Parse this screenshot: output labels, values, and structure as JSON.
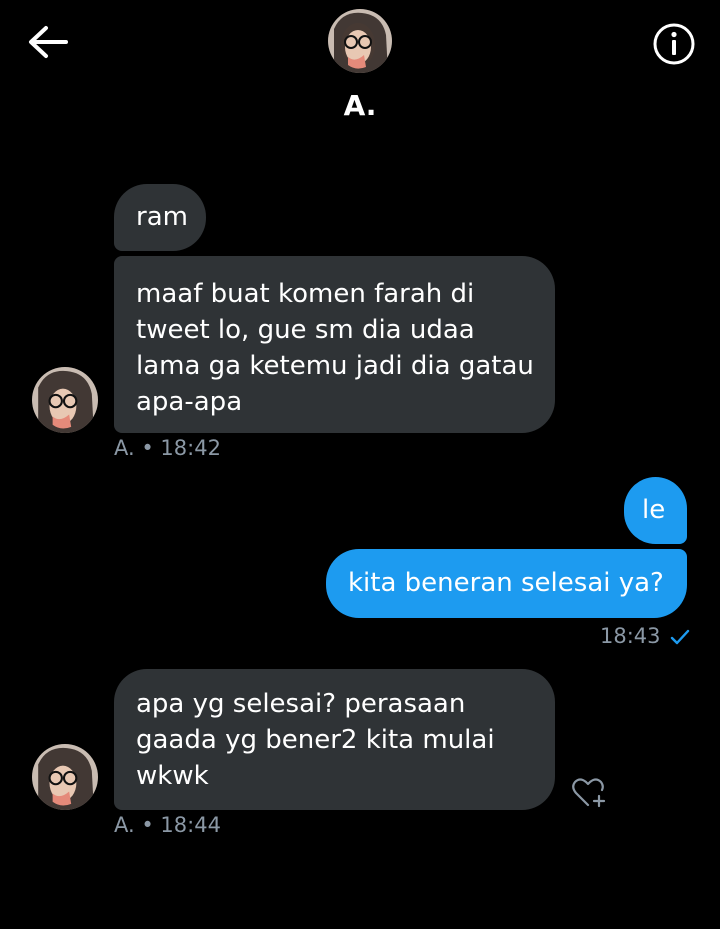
{
  "header": {
    "name": "A.",
    "back_icon": "arrow-left-icon",
    "info_icon": "info-icon"
  },
  "messages": [
    {
      "side": "in",
      "text": "ram"
    },
    {
      "side": "in",
      "lines": [
        "maaf buat komen farah di",
        "tweet lo, gue sm dia udaa",
        "lama ga ketemu jadi dia gatau",
        "apa-apa"
      ]
    },
    {
      "side": "out",
      "text": "le"
    },
    {
      "side": "out",
      "text": "kita beneran selesai ya?"
    },
    {
      "side": "in",
      "lines": [
        "apa yg selesai? perasaan",
        "gaada yg bener2 kita mulai",
        "wkwk"
      ]
    }
  ],
  "meta": {
    "group1": "A. • 18:42",
    "group2_time": "18:43",
    "group3": "A. • 18:44"
  },
  "colors": {
    "incoming": "#2f3336",
    "outgoing": "#1d9bf0",
    "meta": "#8b98a5",
    "check": "#1d9bf0"
  },
  "icons": {
    "like": "heart-plus-icon",
    "read": "check-icon"
  }
}
